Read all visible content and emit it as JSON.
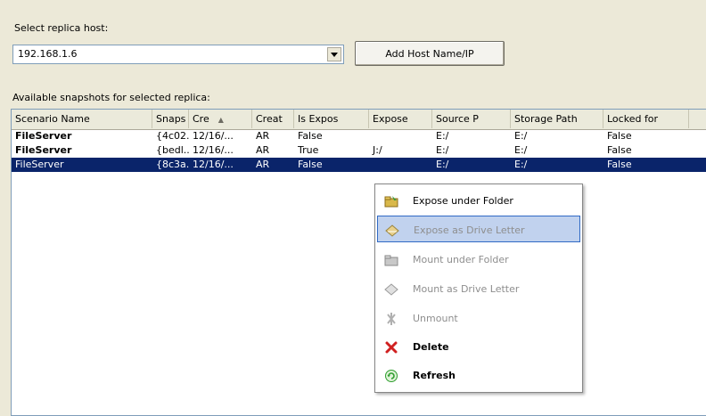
{
  "host": {
    "label": "Select replica host:",
    "value": "192.168.1.6",
    "add_button": "Add Host Name/IP"
  },
  "snapshots": {
    "label": "Available snapshots for selected replica:",
    "columns": [
      "Scenario Name",
      "Snaps",
      "Cre",
      "Creat",
      "Is Expos",
      "Expose",
      "Source P",
      "Storage Path",
      "Locked for"
    ],
    "sort_indicator": "▲",
    "rows": [
      [
        "FileServer",
        "{4c02...",
        "12/16/...",
        "AR",
        "False",
        "",
        "E:/",
        "E:/",
        "False"
      ],
      [
        "FileServer",
        "{bedl...",
        "12/16/...",
        "AR",
        "True",
        "J:/",
        "E:/",
        "E:/",
        "False"
      ],
      [
        "FileServer",
        "{8c3a...",
        "12/16/...",
        "AR",
        "False",
        "",
        "E:/",
        "E:/",
        "False"
      ]
    ]
  },
  "context_menu": {
    "items": [
      {
        "label": "Expose under Folder",
        "icon": "folder-expose-icon",
        "state": "normal"
      },
      {
        "label": "Expose as Drive Letter",
        "icon": "drive-expose-icon",
        "state": "hover-disabled"
      },
      {
        "label": "Mount under Folder",
        "icon": "folder-mount-icon",
        "state": "disabled"
      },
      {
        "label": "Mount as Drive Letter",
        "icon": "drive-mount-icon",
        "state": "disabled"
      },
      {
        "label": "Unmount",
        "icon": "unmount-icon",
        "state": "disabled"
      },
      {
        "label": "Delete",
        "icon": "delete-icon",
        "state": "bold"
      },
      {
        "label": "Refresh",
        "icon": "refresh-icon",
        "state": "bold"
      }
    ]
  },
  "colors": {
    "selection": "#0a246a",
    "hover": "#c1d2ee",
    "delete": "#d02020",
    "refresh": "#2e9e2e"
  }
}
